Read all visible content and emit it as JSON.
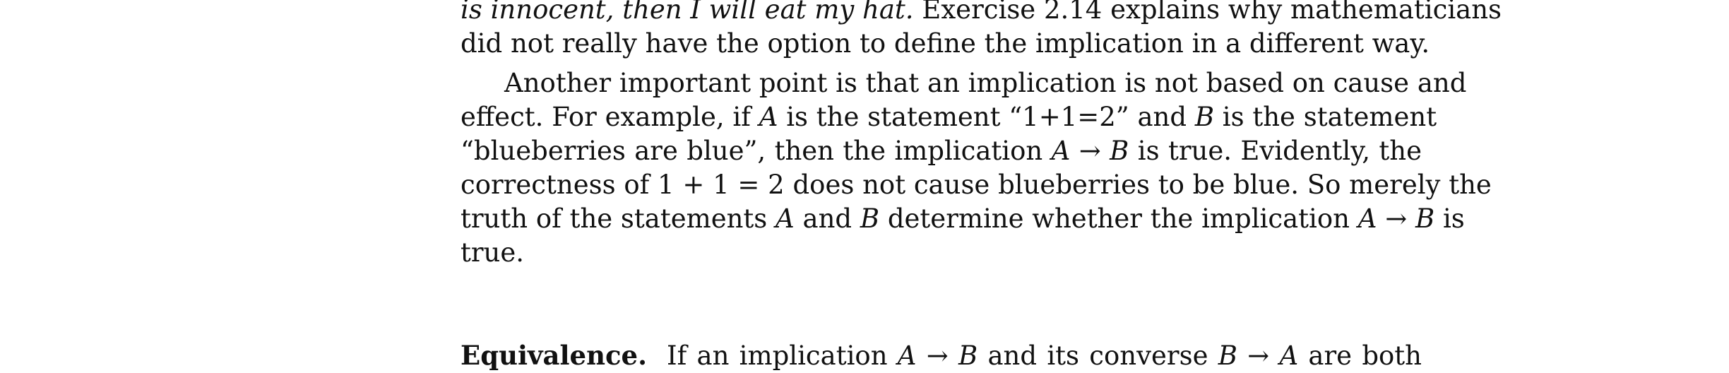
{
  "paragraph1": {
    "line1_italic": "is innocent, then I will eat my hat.",
    "line1_rest": " Exercise 2.14 explains why mathematicians",
    "line2": "did not really have the option to define the implication in a different way."
  },
  "paragraph2": {
    "line1": "Another important point is that an implication is not based on cause and",
    "line2_a": "effect.  For example, if ",
    "line2_A": "A",
    "line2_b": " is the statement “1+1=2” and ",
    "line2_B": "B",
    "line2_c": " is the statement",
    "line3_a": "“blueberries are blue”, then the implication ",
    "line3_A": "A",
    "line3_arrow": " → ",
    "line3_B": "B",
    "line3_b": " is true.  Evidently, the",
    "line4": "correctness of 1 + 1 = 2 does not cause blueberries to be blue. So merely the",
    "line5_a": "truth of the statements ",
    "line5_A": "A",
    "line5_b": " and ",
    "line5_B": "B",
    "line5_c": " determine whether the implication ",
    "line5_A2": "A",
    "line5_arrow": " → ",
    "line5_B2": "B",
    "line5_d": " is",
    "line6": "true."
  },
  "paragraph3": {
    "heading": "Equivalence.",
    "text_a": "If an implication ",
    "A1": "A",
    "arrow1": " → ",
    "B1": "B",
    "text_b": " and its converse ",
    "B2": "B",
    "arrow2": " → ",
    "A2": "A",
    "text_c": " are both"
  }
}
